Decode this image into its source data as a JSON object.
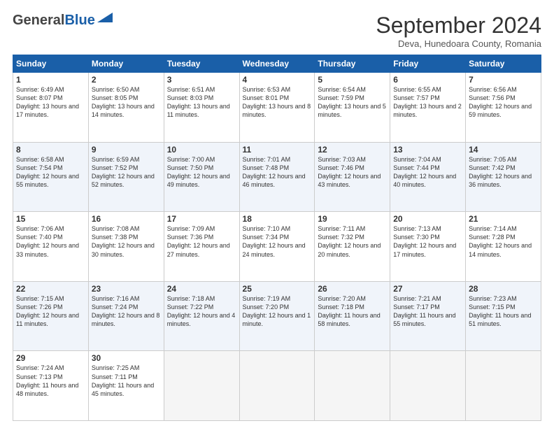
{
  "header": {
    "logo_general": "General",
    "logo_blue": "Blue",
    "month_title": "September 2024",
    "location": "Deva, Hunedoara County, Romania"
  },
  "days_of_week": [
    "Sunday",
    "Monday",
    "Tuesday",
    "Wednesday",
    "Thursday",
    "Friday",
    "Saturday"
  ],
  "weeks": [
    [
      {
        "day": "1",
        "sunrise": "Sunrise: 6:49 AM",
        "sunset": "Sunset: 8:07 PM",
        "daylight": "Daylight: 13 hours and 17 minutes."
      },
      {
        "day": "2",
        "sunrise": "Sunrise: 6:50 AM",
        "sunset": "Sunset: 8:05 PM",
        "daylight": "Daylight: 13 hours and 14 minutes."
      },
      {
        "day": "3",
        "sunrise": "Sunrise: 6:51 AM",
        "sunset": "Sunset: 8:03 PM",
        "daylight": "Daylight: 13 hours and 11 minutes."
      },
      {
        "day": "4",
        "sunrise": "Sunrise: 6:53 AM",
        "sunset": "Sunset: 8:01 PM",
        "daylight": "Daylight: 13 hours and 8 minutes."
      },
      {
        "day": "5",
        "sunrise": "Sunrise: 6:54 AM",
        "sunset": "Sunset: 7:59 PM",
        "daylight": "Daylight: 13 hours and 5 minutes."
      },
      {
        "day": "6",
        "sunrise": "Sunrise: 6:55 AM",
        "sunset": "Sunset: 7:57 PM",
        "daylight": "Daylight: 13 hours and 2 minutes."
      },
      {
        "day": "7",
        "sunrise": "Sunrise: 6:56 AM",
        "sunset": "Sunset: 7:56 PM",
        "daylight": "Daylight: 12 hours and 59 minutes."
      }
    ],
    [
      {
        "day": "8",
        "sunrise": "Sunrise: 6:58 AM",
        "sunset": "Sunset: 7:54 PM",
        "daylight": "Daylight: 12 hours and 55 minutes."
      },
      {
        "day": "9",
        "sunrise": "Sunrise: 6:59 AM",
        "sunset": "Sunset: 7:52 PM",
        "daylight": "Daylight: 12 hours and 52 minutes."
      },
      {
        "day": "10",
        "sunrise": "Sunrise: 7:00 AM",
        "sunset": "Sunset: 7:50 PM",
        "daylight": "Daylight: 12 hours and 49 minutes."
      },
      {
        "day": "11",
        "sunrise": "Sunrise: 7:01 AM",
        "sunset": "Sunset: 7:48 PM",
        "daylight": "Daylight: 12 hours and 46 minutes."
      },
      {
        "day": "12",
        "sunrise": "Sunrise: 7:03 AM",
        "sunset": "Sunset: 7:46 PM",
        "daylight": "Daylight: 12 hours and 43 minutes."
      },
      {
        "day": "13",
        "sunrise": "Sunrise: 7:04 AM",
        "sunset": "Sunset: 7:44 PM",
        "daylight": "Daylight: 12 hours and 40 minutes."
      },
      {
        "day": "14",
        "sunrise": "Sunrise: 7:05 AM",
        "sunset": "Sunset: 7:42 PM",
        "daylight": "Daylight: 12 hours and 36 minutes."
      }
    ],
    [
      {
        "day": "15",
        "sunrise": "Sunrise: 7:06 AM",
        "sunset": "Sunset: 7:40 PM",
        "daylight": "Daylight: 12 hours and 33 minutes."
      },
      {
        "day": "16",
        "sunrise": "Sunrise: 7:08 AM",
        "sunset": "Sunset: 7:38 PM",
        "daylight": "Daylight: 12 hours and 30 minutes."
      },
      {
        "day": "17",
        "sunrise": "Sunrise: 7:09 AM",
        "sunset": "Sunset: 7:36 PM",
        "daylight": "Daylight: 12 hours and 27 minutes."
      },
      {
        "day": "18",
        "sunrise": "Sunrise: 7:10 AM",
        "sunset": "Sunset: 7:34 PM",
        "daylight": "Daylight: 12 hours and 24 minutes."
      },
      {
        "day": "19",
        "sunrise": "Sunrise: 7:11 AM",
        "sunset": "Sunset: 7:32 PM",
        "daylight": "Daylight: 12 hours and 20 minutes."
      },
      {
        "day": "20",
        "sunrise": "Sunrise: 7:13 AM",
        "sunset": "Sunset: 7:30 PM",
        "daylight": "Daylight: 12 hours and 17 minutes."
      },
      {
        "day": "21",
        "sunrise": "Sunrise: 7:14 AM",
        "sunset": "Sunset: 7:28 PM",
        "daylight": "Daylight: 12 hours and 14 minutes."
      }
    ],
    [
      {
        "day": "22",
        "sunrise": "Sunrise: 7:15 AM",
        "sunset": "Sunset: 7:26 PM",
        "daylight": "Daylight: 12 hours and 11 minutes."
      },
      {
        "day": "23",
        "sunrise": "Sunrise: 7:16 AM",
        "sunset": "Sunset: 7:24 PM",
        "daylight": "Daylight: 12 hours and 8 minutes."
      },
      {
        "day": "24",
        "sunrise": "Sunrise: 7:18 AM",
        "sunset": "Sunset: 7:22 PM",
        "daylight": "Daylight: 12 hours and 4 minutes."
      },
      {
        "day": "25",
        "sunrise": "Sunrise: 7:19 AM",
        "sunset": "Sunset: 7:20 PM",
        "daylight": "Daylight: 12 hours and 1 minute."
      },
      {
        "day": "26",
        "sunrise": "Sunrise: 7:20 AM",
        "sunset": "Sunset: 7:18 PM",
        "daylight": "Daylight: 11 hours and 58 minutes."
      },
      {
        "day": "27",
        "sunrise": "Sunrise: 7:21 AM",
        "sunset": "Sunset: 7:17 PM",
        "daylight": "Daylight: 11 hours and 55 minutes."
      },
      {
        "day": "28",
        "sunrise": "Sunrise: 7:23 AM",
        "sunset": "Sunset: 7:15 PM",
        "daylight": "Daylight: 11 hours and 51 minutes."
      }
    ],
    [
      {
        "day": "29",
        "sunrise": "Sunrise: 7:24 AM",
        "sunset": "Sunset: 7:13 PM",
        "daylight": "Daylight: 11 hours and 48 minutes."
      },
      {
        "day": "30",
        "sunrise": "Sunrise: 7:25 AM",
        "sunset": "Sunset: 7:11 PM",
        "daylight": "Daylight: 11 hours and 45 minutes."
      },
      null,
      null,
      null,
      null,
      null
    ]
  ]
}
